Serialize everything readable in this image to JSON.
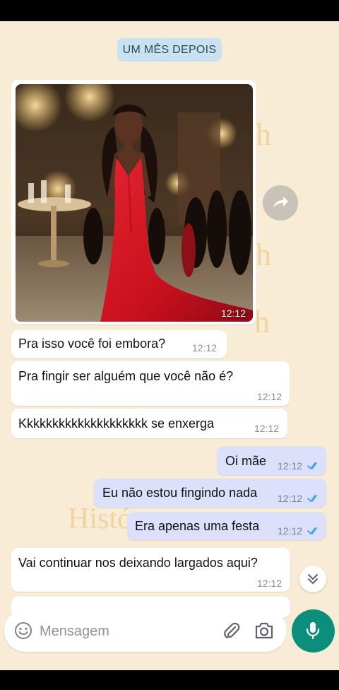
{
  "chat": {
    "date_chip": "UM MÊS DEPOIS",
    "image_message": {
      "time": "12:12"
    },
    "messages": [
      {
        "text": "Pra isso você foi embora?",
        "time": "12:12",
        "dir": "in"
      },
      {
        "text": "Pra fingir ser alguém que você não é?",
        "time": "12:12",
        "dir": "in"
      },
      {
        "text": "Kkkkkkkkkkkkkkkkkkkk se enxerga",
        "time": "12:12",
        "dir": "in"
      },
      {
        "text": "Oi mãe",
        "time": "12:12",
        "dir": "out",
        "status": "read"
      },
      {
        "text": "Eu não estou fingindo nada",
        "time": "12:12",
        "dir": "out",
        "status": "read"
      },
      {
        "text": "Era apenas uma festa",
        "time": "12:12",
        "dir": "out",
        "status": "read"
      },
      {
        "text": "Vai continuar nos deixando largados aqui?",
        "time": "12:12",
        "dir": "in"
      }
    ],
    "watermark": {
      "word_1": "Histó",
      "word_2": "h",
      "word_3": "h",
      "word_4": "h"
    }
  },
  "composer": {
    "placeholder": "Mensagem"
  },
  "icons": {
    "emoji": "emoji-icon",
    "attach": "paperclip-icon",
    "camera": "camera-icon",
    "mic": "microphone-icon",
    "forward": "forward-icon",
    "scroll": "chevron-down-icon",
    "read": "double-check-icon"
  },
  "colors": {
    "chat_background": "#f8ecd6",
    "outgoing_bubble": "#dce0fb",
    "incoming_bubble": "#ffffff",
    "date_chip": "#c8e2f2",
    "read_ticks": "#3fa8e8",
    "mic_button": "#0b8f7c",
    "dress": "#c8101d"
  }
}
